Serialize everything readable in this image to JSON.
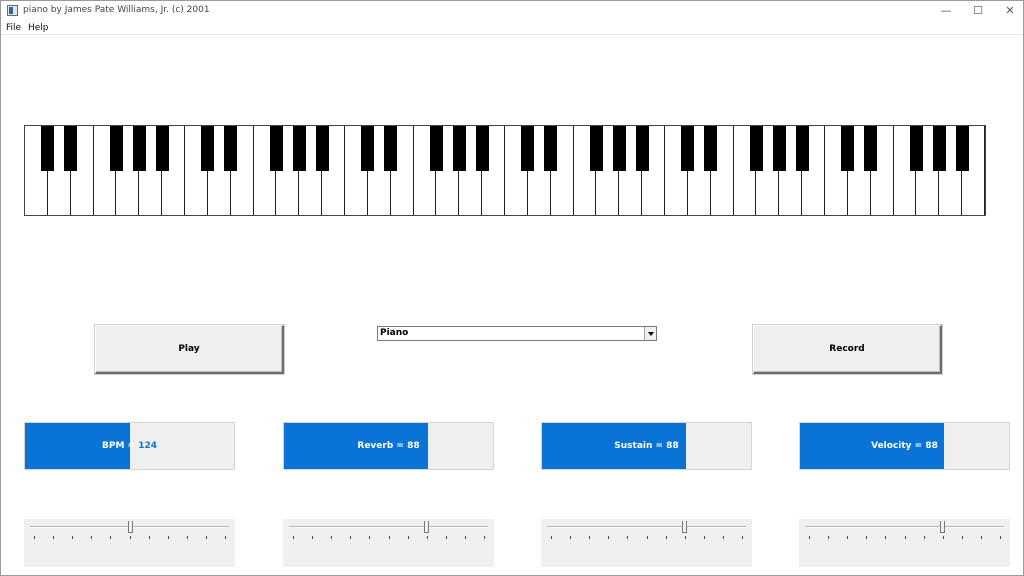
{
  "window": {
    "title": "piano by James Pate Williams, Jr. (c) 2001",
    "minimize_glyph": "—",
    "maximize_glyph": "☐",
    "close_glyph": "✕"
  },
  "menu": {
    "items": [
      {
        "label": "File"
      },
      {
        "label": "Help"
      }
    ]
  },
  "keyboard": {
    "white_keys": 42,
    "black_key_pattern": [
      1,
      1,
      0,
      1,
      1,
      1,
      0
    ]
  },
  "controls": {
    "play_label": "Play",
    "record_label": "Record",
    "instrument": {
      "selected": "Piano"
    }
  },
  "meters": [
    {
      "label": "BPM = 124",
      "fraction": 0.5
    },
    {
      "label": "Reverb = 88",
      "fraction": 0.69
    },
    {
      "label": "Sustain = 88",
      "fraction": 0.69
    },
    {
      "label": "Velocity = 88",
      "fraction": 0.69
    }
  ],
  "sliders": [
    {
      "name": "bpm",
      "fraction": 0.5
    },
    {
      "name": "reverb",
      "fraction": 0.69
    },
    {
      "name": "sustain",
      "fraction": 0.69
    },
    {
      "name": "velocity",
      "fraction": 0.69
    }
  ],
  "colors": {
    "accent": "#0a74d6"
  }
}
